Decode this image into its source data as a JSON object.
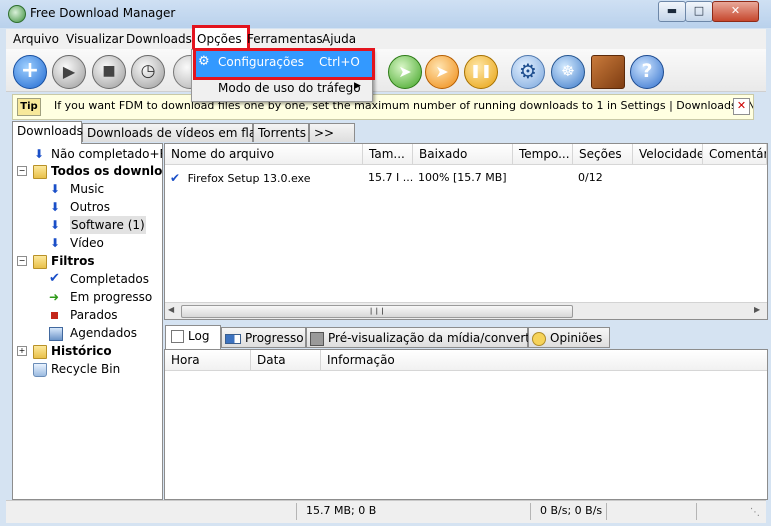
{
  "window": {
    "title": "Free Download Manager"
  },
  "menubar": {
    "items": [
      "Arquivo",
      "Visualizar",
      "Downloads",
      "Opções",
      "Ferramentas",
      "Ajuda"
    ]
  },
  "dropdown": {
    "configuracoes": {
      "label": "Configurações",
      "shortcut": "Ctrl+O"
    },
    "trafego": {
      "label": "Modo de uso do tráfego"
    }
  },
  "tip": {
    "badge": "Tip",
    "text": "If you want FDM to download files one by one, set the maximum number of running downloads to 1 in Settings | Downloads | Network, or click"
  },
  "tabs": [
    "Downloads",
    "Downloads de vídeos em flash",
    "Torrents",
    ">>"
  ],
  "tree": {
    "incompletos": "Não completado+Re",
    "todos": "Todos os downloads",
    "music": "Music",
    "outros": "Outros",
    "software": "Software (1)",
    "video": "Vídeo",
    "filtros": "Filtros",
    "completados": "Completados",
    "emprogresso": "Em progresso",
    "parados": "Parados",
    "agendados": "Agendados",
    "historico": "Histórico",
    "recycle": "Recycle Bin"
  },
  "list": {
    "columns": [
      "Nome do arquivo",
      "Tam...",
      "Baixado",
      "Tempo...",
      "Seções",
      "Velocidade",
      "Comentár"
    ],
    "rows": [
      {
        "name": "Firefox Setup 13.0.exe",
        "size": "15.7 I ...",
        "downloaded": "100% [15.7 MB]",
        "time": "",
        "sections": "0/12",
        "speed": "",
        "comment": ""
      }
    ]
  },
  "bottom_tabs": [
    "Log",
    "Progresso",
    "Pré-visualização da mídia/converter",
    "Opiniões"
  ],
  "log_columns": [
    "Hora",
    "Data",
    "Informação"
  ],
  "status": {
    "size": "15.7 MB; 0 B",
    "speed": "0 B/s; 0 B/s"
  },
  "colors": {
    "highlight": "#e3141e",
    "selection": "#3399ff"
  }
}
